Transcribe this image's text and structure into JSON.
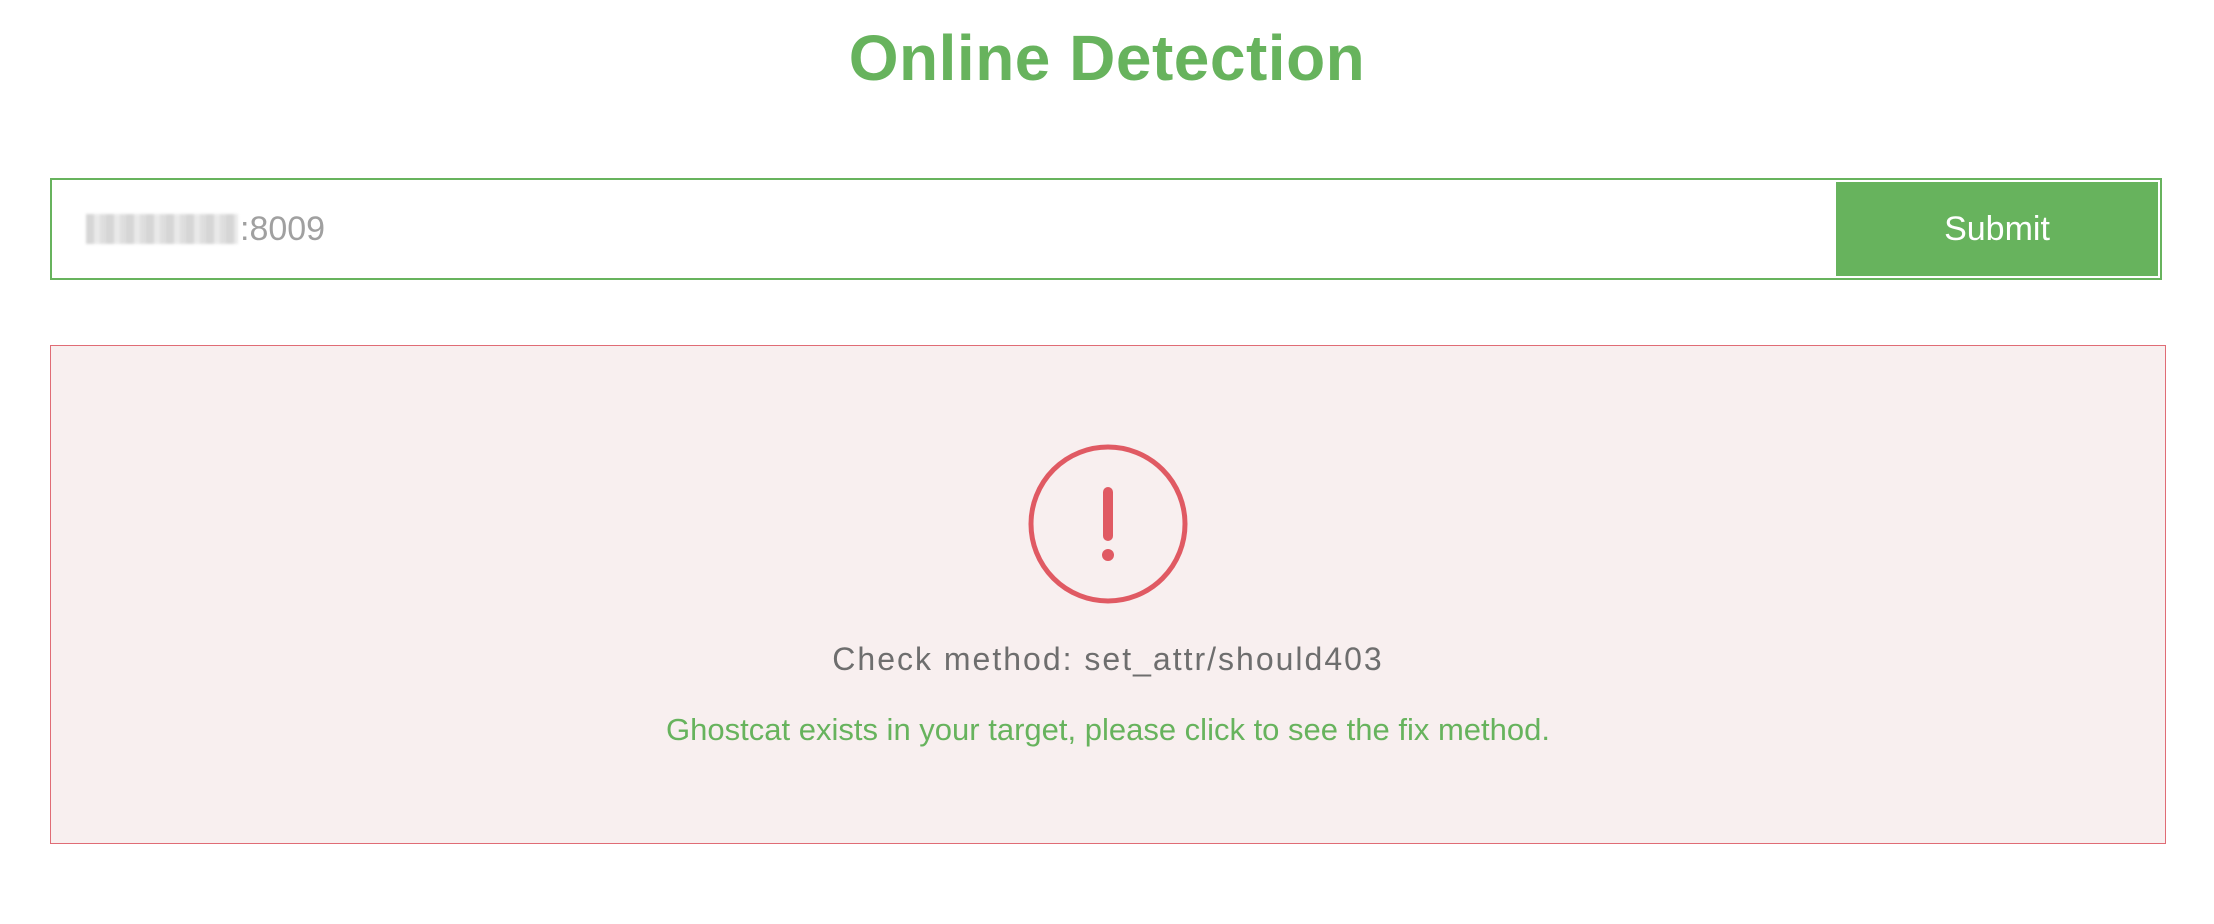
{
  "header": {
    "title": "Online Detection"
  },
  "search": {
    "value_visible": ":8009",
    "submit_label": "Submit"
  },
  "result": {
    "status_icon": "exclamation-circle-icon",
    "check_method": "Check method: set_attr/should403",
    "message": "Ghostcat exists in your target, please click to see the fix method."
  },
  "colors": {
    "accent": "#67b35d",
    "danger": "#e05a63",
    "panel_bg": "#f8efef"
  }
}
